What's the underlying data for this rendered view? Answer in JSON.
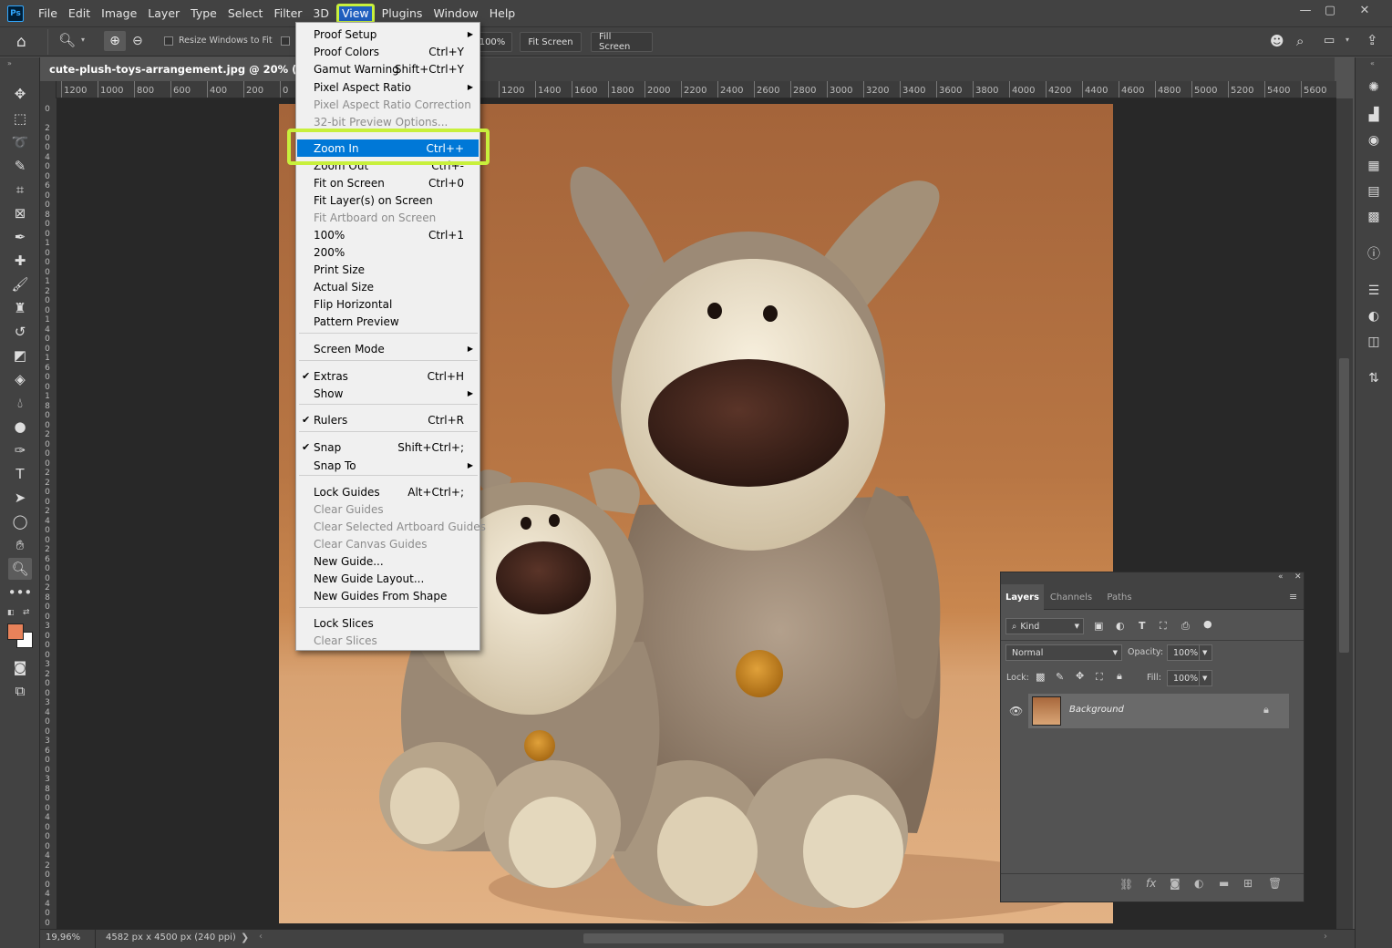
{
  "menubar": {
    "logo": "Ps",
    "items": [
      "File",
      "Edit",
      "Image",
      "Layer",
      "Type",
      "Select",
      "Filter",
      "3D",
      "View",
      "Plugins",
      "Window",
      "Help"
    ],
    "window_buttons": [
      "—",
      "▢",
      "✕"
    ]
  },
  "options": {
    "resize_windows_label": "Resize Windows to Fit",
    "zoom_value": "100%",
    "fit_screen": "Fit Screen",
    "fill_screen": "Fill Screen"
  },
  "document": {
    "tab_title": "cute-plush-toys-arrangement.jpg @ 20% (Layer 0, Re"
  },
  "ruler": {
    "h_ticks": [
      "1200",
      "1000",
      "800",
      "600",
      "400",
      "200",
      "0",
      "",
      "",
      "",
      "",
      "",
      "1200",
      "1400",
      "1600",
      "1800",
      "2000",
      "2200",
      "2400",
      "2600",
      "2800",
      "3000",
      "3200",
      "3400",
      "3600",
      "3800",
      "4000",
      "4200",
      "4400",
      "4600",
      "4800",
      "5000",
      "5200",
      "5400",
      "5600"
    ],
    "v_ticks": [
      "0",
      "",
      "2",
      "0",
      "0",
      "4",
      "0",
      "0",
      "6",
      "0",
      "0",
      "8",
      "0",
      "0",
      "1",
      "0",
      "0",
      "0",
      "1",
      "2",
      "0",
      "0",
      "1",
      "4",
      "0",
      "0",
      "1",
      "6",
      "0",
      "0",
      "1",
      "8",
      "0",
      "0",
      "2",
      "0",
      "0",
      "0",
      "2",
      "2",
      "0",
      "0",
      "2",
      "4",
      "0",
      "0",
      "2",
      "6",
      "0",
      "0",
      "2",
      "8",
      "0",
      "0",
      "3",
      "0",
      "0",
      "0",
      "3",
      "2",
      "0",
      "0",
      "3",
      "4",
      "0",
      "0",
      "3",
      "6",
      "0",
      "0",
      "3",
      "8",
      "0",
      "0",
      "4",
      "0",
      "0",
      "0",
      "4",
      "2",
      "0",
      "0",
      "4",
      "4",
      "0",
      "0"
    ]
  },
  "view_menu": {
    "items": [
      {
        "label": "Proof Setup",
        "shortcut": "",
        "submenu": true,
        "disabled": false
      },
      {
        "label": "Proof Colors",
        "shortcut": "Ctrl+Y",
        "disabled": false
      },
      {
        "label": "Gamut Warning",
        "shortcut": "Shift+Ctrl+Y",
        "disabled": false
      },
      {
        "label": "Pixel Aspect Ratio",
        "shortcut": "",
        "submenu": true,
        "disabled": false
      },
      {
        "label": "Pixel Aspect Ratio Correction",
        "shortcut": "",
        "disabled": true
      },
      {
        "label": "32-bit Preview Options...",
        "shortcut": "",
        "disabled": true
      },
      {
        "label": "Zoom In",
        "shortcut": "Ctrl++",
        "selected": true
      },
      {
        "label": "Zoom Out",
        "shortcut": "Ctrl+-",
        "disabled": false
      },
      {
        "label": "Fit on Screen",
        "shortcut": "Ctrl+0",
        "disabled": false
      },
      {
        "label": "Fit Layer(s) on Screen",
        "shortcut": "",
        "disabled": false
      },
      {
        "label": "Fit Artboard on Screen",
        "shortcut": "",
        "disabled": true
      },
      {
        "label": "100%",
        "shortcut": "Ctrl+1",
        "disabled": false
      },
      {
        "label": "200%",
        "shortcut": "",
        "disabled": false
      },
      {
        "label": "Print Size",
        "shortcut": "",
        "disabled": false
      },
      {
        "label": "Actual Size",
        "shortcut": "",
        "disabled": false
      },
      {
        "label": "Flip Horizontal",
        "shortcut": "",
        "disabled": false
      },
      {
        "label": "Pattern Preview",
        "shortcut": "",
        "disabled": false
      },
      {
        "label": "Screen Mode",
        "shortcut": "",
        "submenu": true,
        "disabled": false
      },
      {
        "label": "Extras",
        "shortcut": "Ctrl+H",
        "checked": true
      },
      {
        "label": "Show",
        "shortcut": "",
        "submenu": true,
        "disabled": false
      },
      {
        "label": "Rulers",
        "shortcut": "Ctrl+R",
        "checked": true
      },
      {
        "label": "Snap",
        "shortcut": "Shift+Ctrl+;",
        "checked": true
      },
      {
        "label": "Snap To",
        "shortcut": "",
        "submenu": true,
        "disabled": false
      },
      {
        "label": "Lock Guides",
        "shortcut": "Alt+Ctrl+;",
        "disabled": false
      },
      {
        "label": "Clear Guides",
        "shortcut": "",
        "disabled": true
      },
      {
        "label": "Clear Selected Artboard Guides",
        "shortcut": "",
        "disabled": true
      },
      {
        "label": "Clear Canvas Guides",
        "shortcut": "",
        "disabled": true
      },
      {
        "label": "New Guide...",
        "shortcut": "",
        "disabled": false
      },
      {
        "label": "New Guide Layout...",
        "shortcut": "",
        "disabled": false
      },
      {
        "label": "New Guides From Shape",
        "shortcut": "",
        "disabled": false
      },
      {
        "label": "Lock Slices",
        "shortcut": "",
        "disabled": false
      },
      {
        "label": "Clear Slices",
        "shortcut": "",
        "disabled": true
      }
    ]
  },
  "layers_panel": {
    "tabs": [
      "Layers",
      "Channels",
      "Paths"
    ],
    "kind_label": "Kind",
    "blend_mode": "Normal",
    "opacity_label": "Opacity:",
    "opacity_value": "100%",
    "lock_label": "Lock:",
    "fill_label": "Fill:",
    "fill_value": "100%",
    "layer_name": "Background"
  },
  "status": {
    "zoom": "19,96%",
    "doc_info": "4582 px x 4500 px (240 ppi)"
  },
  "colors": {
    "highlight": "#c8f03c",
    "menu_selection": "#0078d7",
    "foreground": "#e8825a",
    "background": "#ffffff"
  }
}
